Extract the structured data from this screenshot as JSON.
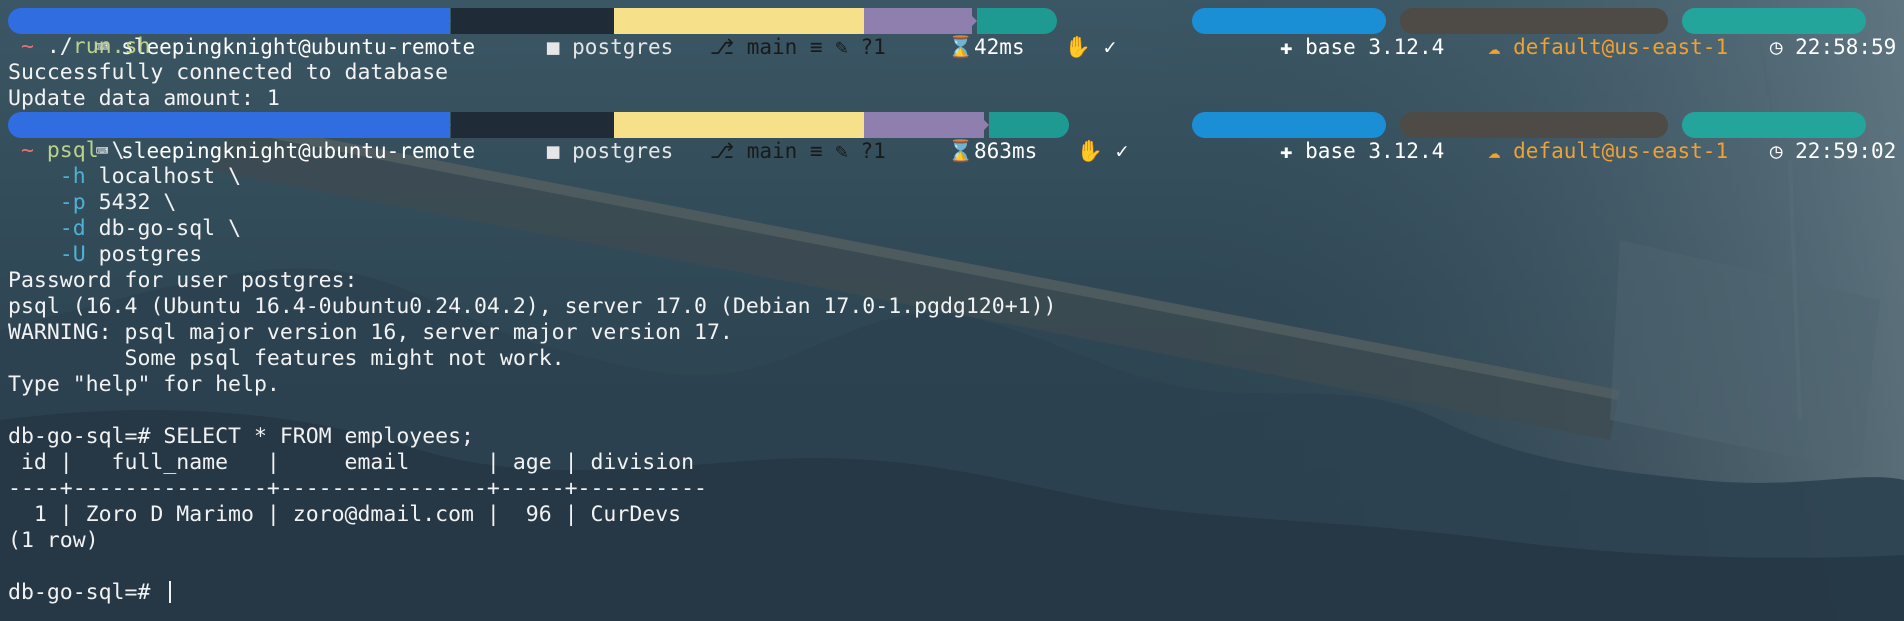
{
  "prompts": [
    {
      "user": "sleepingknight@ubuntu-remote",
      "dir": "postgres",
      "git": "main ≡ ✎ ?1",
      "duration": "42ms",
      "status": "✓",
      "python": "base 3.12.4",
      "aws": "default@us-east-1",
      "time": "22:58:59"
    },
    {
      "user": "sleepingknight@ubuntu-remote",
      "dir": "postgres",
      "git": "main ≡ ✎ ?1",
      "duration": "863ms",
      "status": "✓",
      "python": "base 3.12.4",
      "aws": "default@us-east-1",
      "time": "22:59:02"
    }
  ],
  "commands": {
    "first": {
      "tilde": "~",
      "dot": "./",
      "script": "run.sh"
    },
    "second": {
      "tilde": "~",
      "psql": "psql",
      "cont": " \\",
      "args": [
        {
          "flag": "-h",
          "value": "localhost \\"
        },
        {
          "flag": "-p",
          "value": "5432 \\"
        },
        {
          "flag": "-d",
          "value": "db-go-sql \\"
        },
        {
          "flag": "-U",
          "value": "postgres"
        }
      ]
    }
  },
  "output1": [
    "Successfully connected to database",
    "Update data amount: 1"
  ],
  "output2": [
    "Password for user postgres:",
    "psql (16.4 (Ubuntu 16.4-0ubuntu0.24.04.2), server 17.0 (Debian 17.0-1.pgdg120+1))",
    "WARNING: psql major version 16, server major version 17.",
    "         Some psql features might not work.",
    "Type \"help\" for help.",
    "",
    "db-go-sql=# SELECT * FROM employees;",
    " id |   full_name   |     email      | age | division",
    "----+---------------+----------------+-----+----------",
    "  1 | Zoro D Marimo | zoro@dmail.com |  96 | CurDevs",
    "(1 row)",
    ""
  ],
  "final_prompt": "db-go-sql=# ",
  "colors": {
    "user_bg": "#2f6de1",
    "dir_bg": "#1f2b36",
    "git_bg": "#f7e08a",
    "time_seg_bg": "#8e7fae",
    "status_bg": "#1e9a92",
    "python_bg": "#1b8fd6",
    "aws_bg": "#4e4a45",
    "aws_fg": "#f0a133",
    "clock_bg": "#23a59c"
  }
}
